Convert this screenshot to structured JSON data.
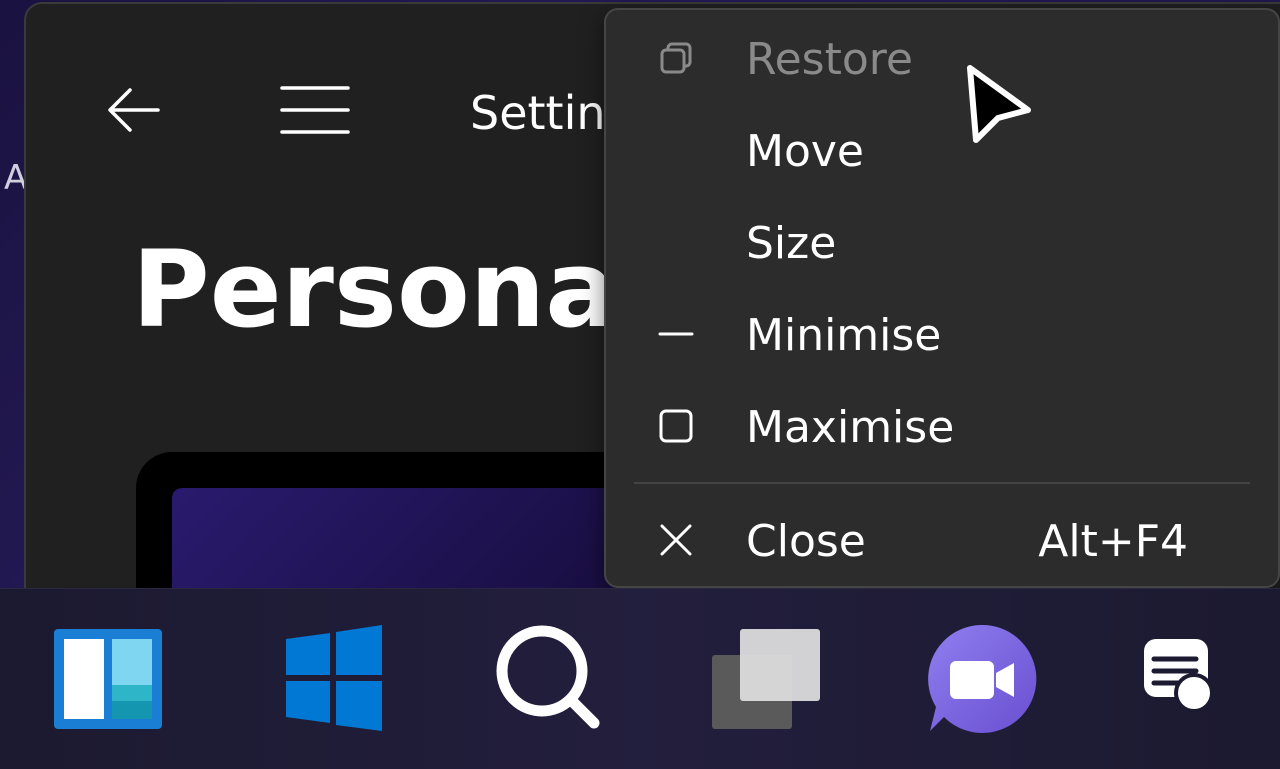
{
  "desktop": {
    "edge_text": "A"
  },
  "window": {
    "title": "Settin",
    "page_title": "Personal"
  },
  "context_menu": {
    "items": [
      {
        "label": "Restore",
        "icon": "restore-icon",
        "disabled": true
      },
      {
        "label": "Move",
        "icon": "",
        "disabled": false
      },
      {
        "label": "Size",
        "icon": "",
        "disabled": false
      },
      {
        "label": "Minimise",
        "icon": "minimise-icon",
        "disabled": false
      },
      {
        "label": "Maximise",
        "icon": "maximise-icon",
        "disabled": false
      },
      {
        "label": "Close",
        "icon": "close-icon",
        "shortcut": "Alt+F4",
        "disabled": false
      }
    ]
  },
  "taskbar": {
    "items": [
      "widgets-icon",
      "start-icon",
      "search-icon",
      "task-view-icon",
      "teams-chat-icon",
      "feedback-icon"
    ]
  },
  "colors": {
    "window_bg": "#202020",
    "menu_bg": "#2c2c2c",
    "teams_purple": "#7b6ee0",
    "widgets_blue": "#1a7fd4",
    "windows_blue": "#0078d4"
  }
}
